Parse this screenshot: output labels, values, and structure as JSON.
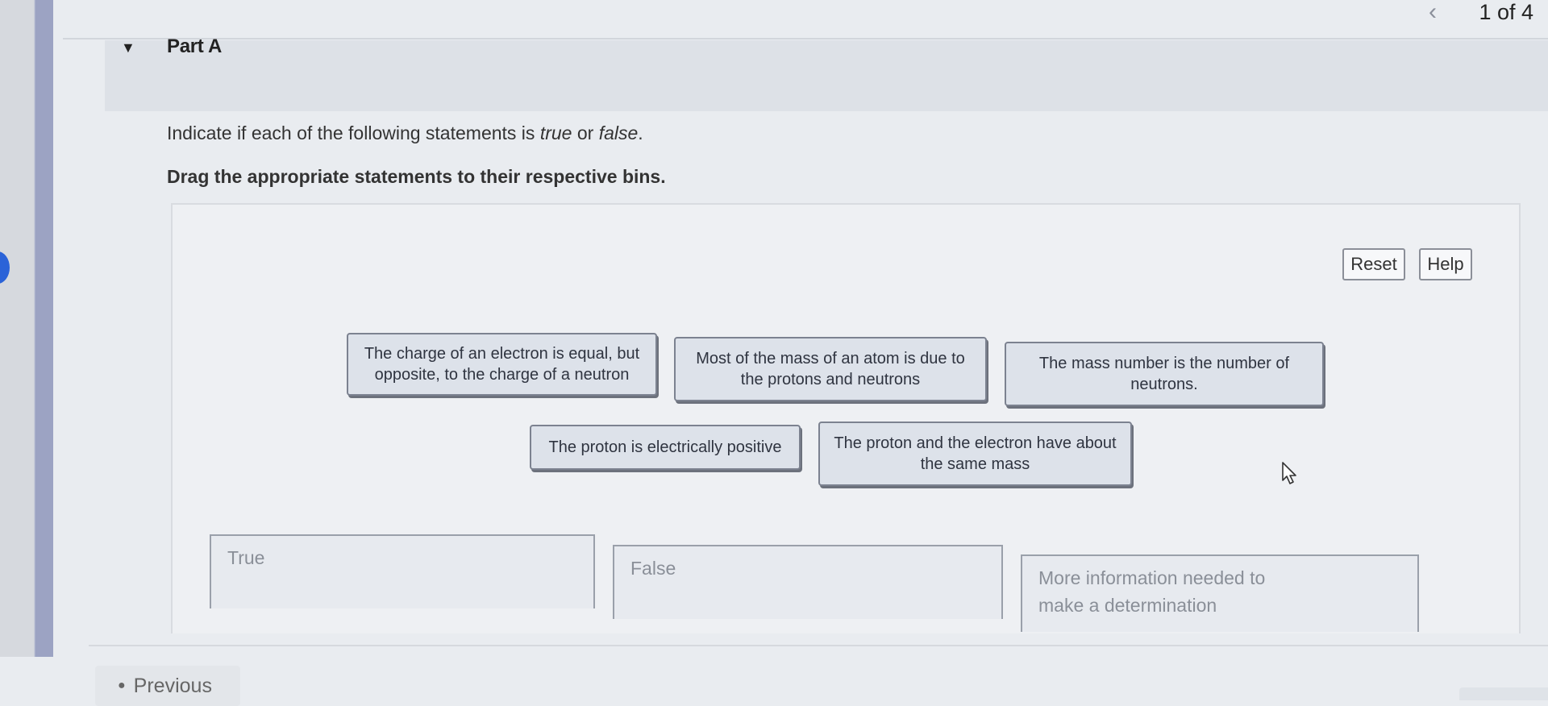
{
  "pager": {
    "text": "1 of 4",
    "prev_icon": "chevron-left-icon"
  },
  "part": {
    "toggle_icon": "triangle-down-icon",
    "title": "Part A"
  },
  "instructions": {
    "line1_before": "Indicate if each of the following statements is ",
    "line1_true": "true",
    "line1_mid": " or ",
    "line1_false": "false",
    "line1_end": ".",
    "line2": "Drag the appropriate statements to their respective bins."
  },
  "toolbar": {
    "reset_label": "Reset",
    "help_label": "Help"
  },
  "statements": [
    "The charge of an electron is equal, but opposite, to the charge of a neutron",
    "Most of the mass of an atom is due to the protons and neutrons",
    "The mass number is the number of neutrons.",
    "The proton is electrically positive",
    "The proton and the electron have about the same mass"
  ],
  "bins": [
    {
      "label": "True"
    },
    {
      "label": "False"
    },
    {
      "label": "More information needed to make a determination"
    }
  ],
  "nav": {
    "previous_label": "Previous"
  }
}
